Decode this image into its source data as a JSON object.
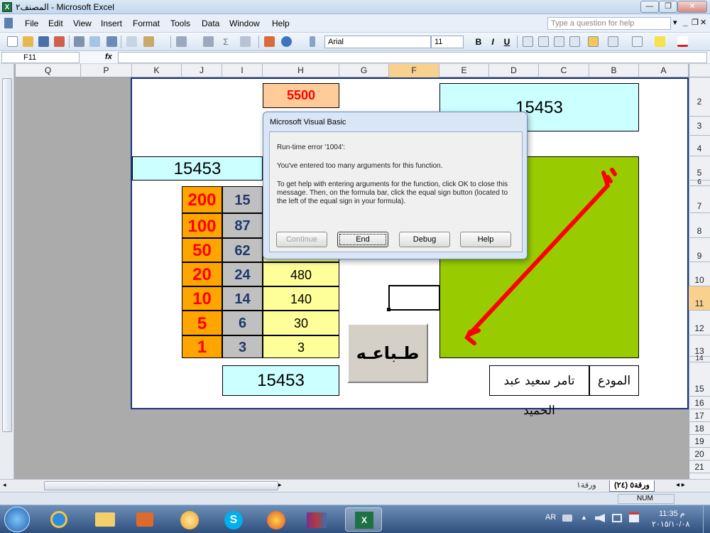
{
  "window": {
    "title": "المصنف٢ - Microsoft Excel",
    "app_icon_letter": "X",
    "controls": {
      "minimize": "—",
      "restore": "❐",
      "close": "✕"
    }
  },
  "menu": {
    "items": [
      "File",
      "Edit",
      "View",
      "Insert",
      "Format",
      "Tools",
      "Data",
      "Window",
      "Help"
    ],
    "help_placeholder": "Type a question for help",
    "right_controls": {
      "dropdown": "▾",
      "minimize": "_",
      "restore": "❐",
      "close": "✕"
    }
  },
  "toolbar": {
    "font": "Arial",
    "font_size": "11",
    "bold": "B",
    "italic": "I",
    "underline": "U",
    "sigma": "Σ"
  },
  "formula_bar": {
    "name_box": "F11",
    "fx_label": "fx",
    "formula": ""
  },
  "columns": [
    "Q",
    "P",
    "K",
    "J",
    "I",
    "H",
    "G",
    "F",
    "E",
    "D",
    "C",
    "B",
    "A"
  ],
  "selected_column": "F",
  "rows": [
    "2",
    "3",
    "4",
    "5",
    "6",
    "7",
    "8",
    "9",
    "10",
    "11",
    "12",
    "13",
    "14",
    "15",
    "16",
    "17",
    "18",
    "19",
    "20",
    "21"
  ],
  "selected_row": "11",
  "sheet": {
    "header_top": "5500",
    "total_top_right": "15453",
    "total_left": "15453",
    "total_bottom": "15453",
    "denominations": [
      {
        "denomination": "200",
        "count": "15",
        "value": ""
      },
      {
        "denomination": "100",
        "count": "87",
        "value": ""
      },
      {
        "denomination": "50",
        "count": "62",
        "value": ""
      },
      {
        "denomination": "20",
        "count": "24",
        "value": "480"
      },
      {
        "denomination": "10",
        "count": "14",
        "value": "140"
      },
      {
        "denomination": "5",
        "count": "6",
        "value": "30"
      },
      {
        "denomination": "1",
        "count": "3",
        "value": "3"
      }
    ],
    "print_button": "طـباعـه",
    "depositor_label": "المودع",
    "depositor_name": "تامر سعيد عبد الحميد",
    "signature_color": "#ff0000",
    "panel_color": "#99cc00"
  },
  "dialog": {
    "title": "Microsoft Visual Basic",
    "error_line": "Run-time error '1004':",
    "message": "You've entered too many arguments for this function.",
    "help_text": "To get help with entering arguments for the function, click OK to close this message. Then, on the formula bar, click the equal sign button (located to the left of the equal sign in your formula).",
    "buttons": {
      "continue": "Continue",
      "end": "End",
      "debug": "Debug",
      "help": "Help"
    }
  },
  "tabs": {
    "nav": "◂ ▸",
    "active": "ورقة٥ (٢٤)",
    "other": "ورقة١"
  },
  "status": {
    "num": "NUM"
  },
  "taskbar": {
    "language": "AR",
    "time": "11:35 م",
    "date": "٢٠١٥/١٠/٠٨"
  }
}
